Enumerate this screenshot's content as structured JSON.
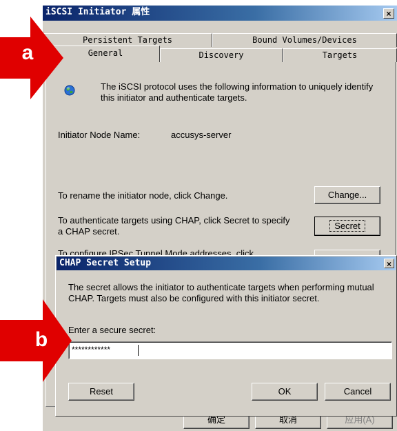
{
  "initiator_dialog": {
    "title": "iSCSI Initiator 属性",
    "close": "×",
    "tabs_row1": [
      "Persistent Targets",
      "Bound Volumes/Devices"
    ],
    "tabs_row2": [
      "General",
      "Discovery",
      "Targets"
    ],
    "active_tab": "General",
    "description": "The iSCSI protocol uses the following information to uniquely identify this initiator and authenticate targets.",
    "node_name_label": "Initiator Node Name:",
    "node_name_value": "accusys-server",
    "rename_text": "To rename the initiator node, click Change.",
    "change_button": "Change...",
    "chap_text": "To authenticate targets using CHAP, click Secret to specify a CHAP secret.",
    "secret_button": "Secret",
    "ipsec_text": "To configure IPSec Tunnel Mode addresses, click",
    "ok_button": "确定",
    "cancel_button": "取消",
    "apply_button": "应用(A)"
  },
  "chap_dialog": {
    "title": "CHAP Secret Setup",
    "close": "×",
    "description": "The secret allows the initiator to authenticate targets when performing mutual CHAP.  Targets must also be configured with this initiator secret.",
    "secret_label": "Enter a secure secret:",
    "secret_value": "************",
    "reset_button": "Reset",
    "ok_button": "OK",
    "cancel_button": "Cancel"
  },
  "annotations": {
    "marker_a": "a",
    "marker_b": "b"
  },
  "colors": {
    "marker": "#e00000",
    "titlebar": "#0a246a",
    "window": "#d4d0c8"
  }
}
